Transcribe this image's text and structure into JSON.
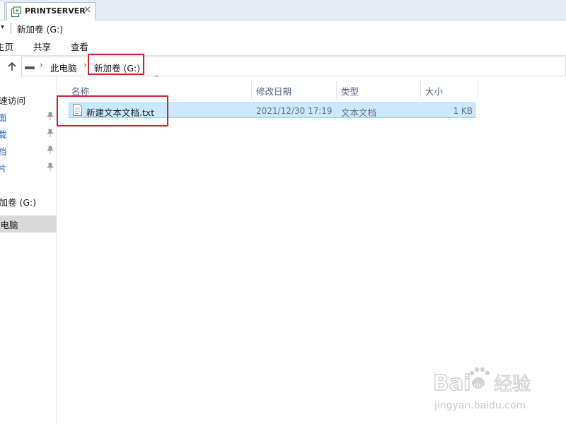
{
  "tab": {
    "title": "PRINTSERVER",
    "close": "✕",
    "icon": "printserver-icon"
  },
  "titlebar": {
    "qat_arrow": "▾",
    "title": "新加卷 (G:)"
  },
  "ribbon": {
    "home": "主页",
    "share": "共享",
    "view": "查看"
  },
  "address": {
    "crumbs": [
      "此电脑",
      "新加卷 (G:)"
    ],
    "separator": "›",
    "up_icon": "up-arrow-icon",
    "drive_icon": "drive-icon"
  },
  "nav": {
    "quick_access": "快速访问",
    "pinned_fragments": [
      "面",
      "载",
      "档",
      "片"
    ],
    "drive": "新加卷 (G:)",
    "this_pc": "此电脑"
  },
  "columns": {
    "sort_indicator": "⌃",
    "headers": [
      "名称",
      "修改日期",
      "类型",
      "大小"
    ]
  },
  "files": [
    {
      "name": "新建文本文档.txt",
      "modified": "2021/12/30 17:19",
      "type": "文本文档",
      "size": "1 KB",
      "icon": "text-file-icon"
    }
  ],
  "colors": {
    "selection_bg": "#cce8ff",
    "selection_border": "#99d1ff",
    "annotation_red": "#d2222d",
    "nav_selected_bg": "#d9d9d9"
  },
  "watermark": {
    "logo": "Baidu 经验",
    "url": "jingyan.baidu.com"
  }
}
